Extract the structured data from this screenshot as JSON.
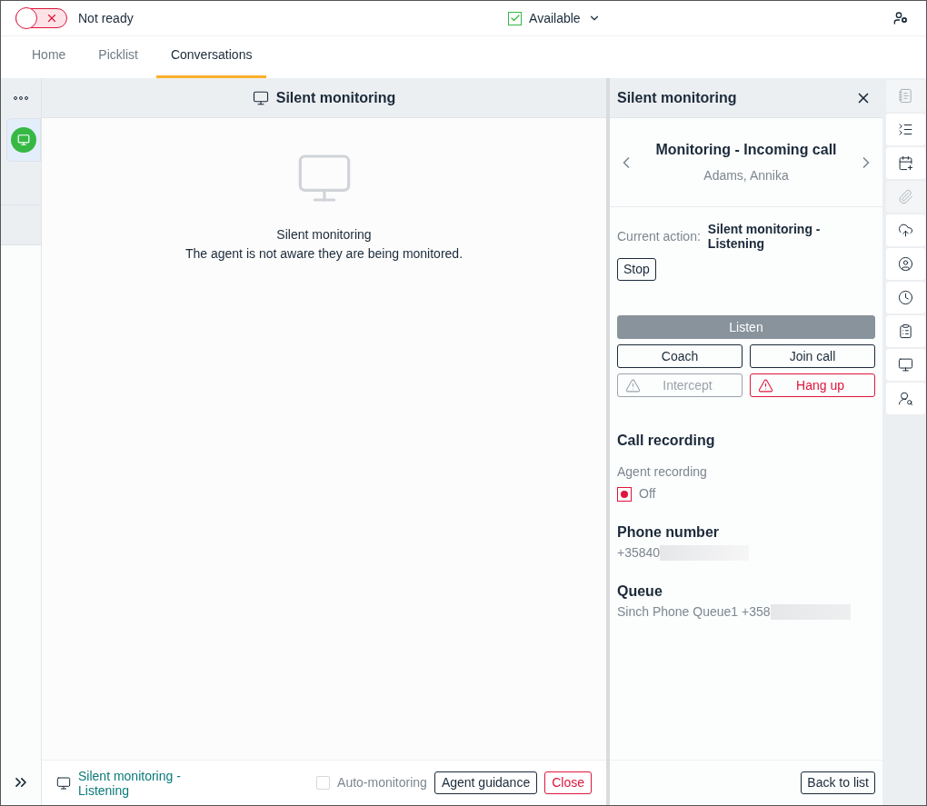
{
  "top_bar": {
    "status_toggle": {
      "on": false,
      "label": "Not ready"
    },
    "availability": {
      "checked": true,
      "label": "Available"
    }
  },
  "tabs": [
    {
      "label": "Home",
      "selected": false
    },
    {
      "label": "Picklist",
      "selected": false
    },
    {
      "label": "Conversations",
      "selected": true
    }
  ],
  "conversation_list": [
    {
      "selected": true
    }
  ],
  "center": {
    "title": "Silent monitoring",
    "empty_title": "Silent monitoring",
    "empty_text": "The agent is not aware they are being monitored.",
    "footer": {
      "status": "Silent monitoring - Listening",
      "auto_monitoring": {
        "label": "Auto-monitoring",
        "checked": false
      },
      "buttons": [
        {
          "label": "Agent guidance",
          "kind": "outline"
        },
        {
          "label": "Close",
          "kind": "danger"
        }
      ]
    }
  },
  "panel": {
    "title": "Silent monitoring",
    "call_title": "Monitoring - Incoming call",
    "caller": "Adams, Annika",
    "current_action_label": "Current action:",
    "current_action": "Silent monitoring - Listening",
    "stop": "Stop",
    "actions": [
      {
        "label": "Listen",
        "kind": "filled",
        "disabled": false
      },
      {
        "label": "Coach",
        "kind": "outline",
        "disabled": false
      },
      {
        "label": "Join call",
        "kind": "outline",
        "disabled": false
      },
      {
        "label": "Intercept",
        "kind": "warning",
        "disabled": true
      },
      {
        "label": "Hang up",
        "kind": "danger",
        "disabled": false
      }
    ],
    "recording": {
      "heading": "Call recording",
      "label": "Agent recording",
      "on": false,
      "value": "Off"
    },
    "phone": {
      "heading": "Phone number",
      "value": "+35840"
    },
    "queue": {
      "heading": "Queue",
      "value": "Sinch Phone Queue1 +358"
    },
    "back": "Back to list"
  },
  "side_rail": [
    {
      "kind": "notes",
      "disabled": true
    },
    {
      "kind": "list",
      "disabled": false
    },
    {
      "kind": "calendar",
      "disabled": false
    },
    {
      "kind": "paperclip",
      "disabled": true
    },
    {
      "kind": "upload",
      "disabled": false
    },
    {
      "kind": "user",
      "disabled": false
    },
    {
      "kind": "clock-user",
      "disabled": false
    },
    {
      "kind": "clipboard-user",
      "disabled": false
    },
    {
      "kind": "monitor",
      "disabled": false
    },
    {
      "kind": "user-search",
      "disabled": false
    }
  ]
}
